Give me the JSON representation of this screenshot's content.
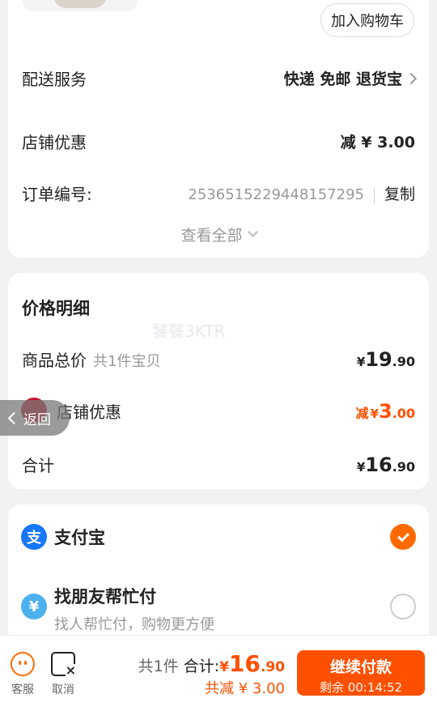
{
  "product": {
    "add_to_cart_label": "加入购物车"
  },
  "delivery": {
    "label": "配送服务",
    "value": "快递 免邮 退货宝"
  },
  "shop_discount": {
    "label": "店铺优惠",
    "value": "减 ¥ 3.00"
  },
  "order": {
    "label": "订单编号:",
    "number": "2536515229448157295",
    "copy_label": "复制"
  },
  "view_all_label": "查看全部",
  "price_detail": {
    "title": "价格明细",
    "watermark": "饕餮3KTR",
    "goods_label": "商品总价",
    "goods_count": "共1件宝贝",
    "goods_price": {
      "currency": "¥",
      "int": "19",
      "dec": ".90"
    },
    "shop_discount_label": "店铺优惠",
    "shop_discount_price": {
      "prefix": "减",
      "currency": "¥",
      "int": "3",
      "dec": ".00"
    },
    "total_label": "合计",
    "total_price": {
      "currency": "¥",
      "int": "16",
      "dec": ".90"
    }
  },
  "back_label": "返回",
  "payment": {
    "alipay": {
      "name": "支付宝",
      "icon": "支",
      "selected": true
    },
    "friend": {
      "name": "找朋友帮忙付",
      "sub": "找人帮忙付，购物更方便",
      "icon": "¥",
      "selected": false
    }
  },
  "bottom_bar": {
    "service_label": "客服",
    "cancel_label": "取消",
    "count_label": "共1件",
    "total_label": "合计:",
    "total": {
      "currency": "¥",
      "int": "16",
      "dec": ".90"
    },
    "saved": "共减 ¥ 3.00",
    "pay_button": "继续付款",
    "countdown": "剩余 00:14:52"
  },
  "colors": {
    "accent": "#ff5000",
    "alipay": "#1677ff",
    "background": "#f2f2f2"
  }
}
